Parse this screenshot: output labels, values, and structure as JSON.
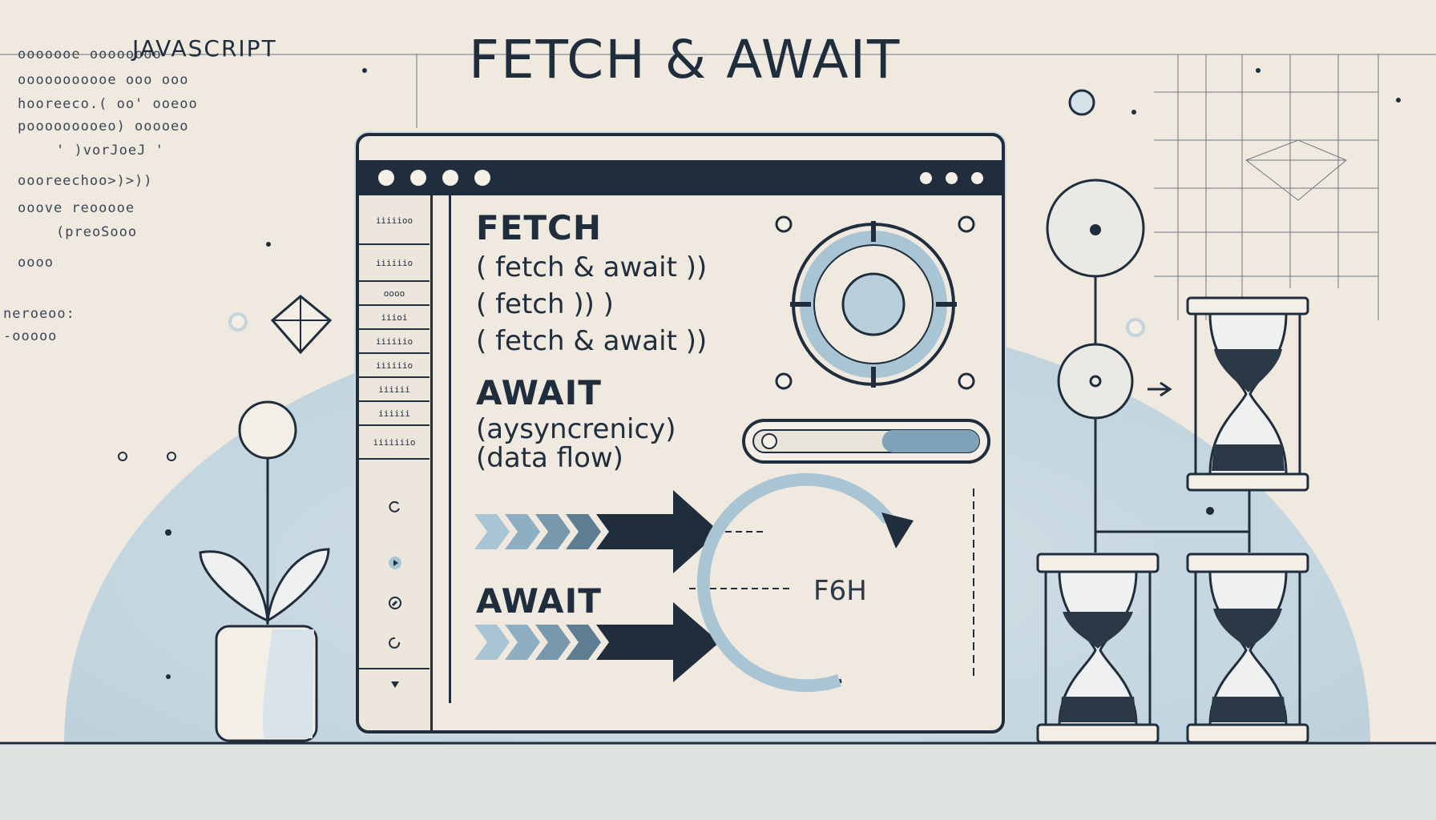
{
  "header": {
    "language_label": "JAVASCRIPT",
    "title": "FETCH & AWAIT"
  },
  "code_lines": [
    "ooooooe  oooooooo",
    "ooooooooooe  ooo  ooo",
    "hooreeco.(   oo'   ooeoo",
    "pooooooooeo)  ooooeo",
    "' )vorJoeJ  '",
    "oooreechoo>)>))",
    "ooove  reooooe",
    "(preoSooo",
    "oooo",
    "neroeoo:",
    "-ooooo"
  ],
  "window": {
    "sidebar_items": [
      "iiiiioo",
      "iiiiiio",
      "oooo",
      "iiioi",
      "iiiiiio",
      "iiiiiio",
      "iiiiii",
      "iiiiii",
      "iiiiiiio"
    ]
  },
  "content": {
    "fetch_heading": "FETCH",
    "fetch_line_1": "( fetch & await ))",
    "fetch_line_2": "( fetch ))      )",
    "fetch_line_3": "( fetch & await ))",
    "await_heading": "AWAIT",
    "await_line_1": "(aysyncrenicy)",
    "await_line_2": "(data flow)",
    "await_heading_2": "AWAIT",
    "spinner_label": "F6H"
  },
  "progress": {
    "value": 0.57
  },
  "colors": {
    "ink": "#1f2d3d",
    "accent_blue": "#a9c4d3",
    "backdrop_blue": "#c9d8e0",
    "paper": "#efe9df"
  },
  "icons": [
    "diamond-icon",
    "plant-icon",
    "hourglass-icon",
    "circular-arrow-icon",
    "arrow-right-icon"
  ]
}
